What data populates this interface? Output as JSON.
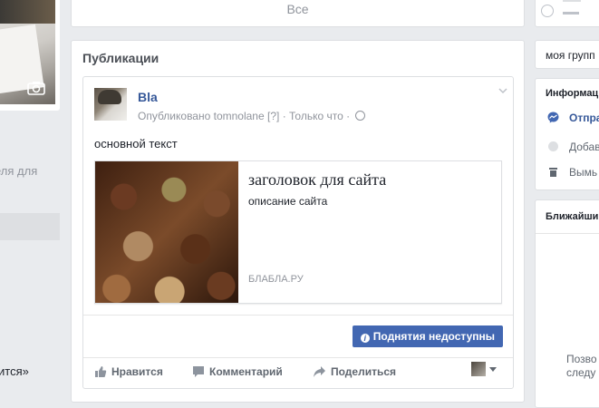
{
  "left": {
    "sidebar_text": "еля для",
    "bottom_text": "ится»"
  },
  "tabs": {
    "all_label": "Все"
  },
  "publications": {
    "title": "Публикации",
    "post": {
      "author": "Bla",
      "meta_published": "Опубликовано tomnolane",
      "meta_help": "[?]",
      "meta_sep": "·",
      "meta_audience": "Только что",
      "text": "основной текст",
      "link": {
        "title": "заголовок для сайта",
        "description": "описание сайта",
        "domain": "БЛАБЛА.РУ"
      },
      "boost_label": "Поднятия недоступны",
      "actions": {
        "like": "Нравится",
        "comment": "Комментарий",
        "share": "Поделиться"
      }
    }
  },
  "right": {
    "group_name": "моя групп",
    "info_heading": "Информац",
    "info_items": [
      "Отпра",
      "Добав",
      "Вымь"
    ],
    "nearby_heading": "Ближайши",
    "nearby_text_1": "Позво",
    "nearby_text_2": "следу"
  },
  "colors": {
    "link_blue": "#365899",
    "button_blue": "#4267b2",
    "page_bg": "#e9ebee"
  },
  "icons": [
    "camera-icon",
    "globe-icon",
    "chevron-down-icon",
    "info-icon",
    "thumbs-up-icon",
    "comment-icon",
    "share-icon",
    "messenger-icon",
    "add-icon",
    "trash-icon"
  ]
}
